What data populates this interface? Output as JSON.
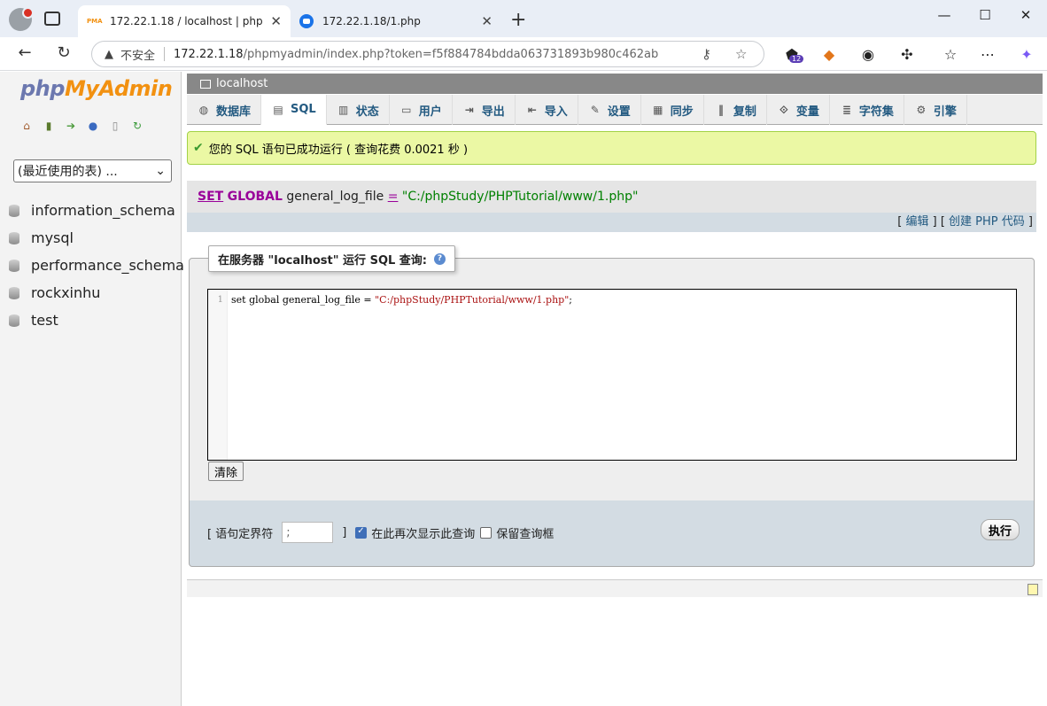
{
  "browser": {
    "tabs": [
      {
        "title": "172.22.1.18 / localhost | phpMyAdmin",
        "favicon": "pma-icon",
        "active": true
      },
      {
        "title": "172.22.1.18/1.php",
        "favicon": "chat-icon",
        "active": false
      }
    ],
    "omnibox": {
      "security_label": "不安全",
      "host": "172.22.1.18",
      "path": "/phpmyadmin/index.php?token=f5f884784bdda063731893b980c462ab"
    },
    "extension_badge": "12"
  },
  "sidebar": {
    "logo": {
      "php": "php",
      "my": "My",
      "admin": "Admin"
    },
    "recent_select": "(最近使用的表) ...",
    "databases": [
      "information_schema",
      "mysql",
      "performance_schema",
      "rockxinhu",
      "test"
    ]
  },
  "server_bar": {
    "label": "localhost"
  },
  "topmenu": [
    {
      "label": "数据库",
      "icon": "database-icon"
    },
    {
      "label": "SQL",
      "icon": "sql-icon"
    },
    {
      "label": "状态",
      "icon": "status-icon"
    },
    {
      "label": "用户",
      "icon": "users-icon"
    },
    {
      "label": "导出",
      "icon": "export-icon"
    },
    {
      "label": "导入",
      "icon": "import-icon"
    },
    {
      "label": "设置",
      "icon": "wrench-icon"
    },
    {
      "label": "同步",
      "icon": "sync-icon"
    },
    {
      "label": "复制",
      "icon": "replication-icon"
    },
    {
      "label": "变量",
      "icon": "variables-icon"
    },
    {
      "label": "字符集",
      "icon": "charset-icon"
    },
    {
      "label": "引擎",
      "icon": "engines-icon"
    }
  ],
  "success_message": "您的 SQL 语句已成功运行 ( 查询花费 0.0021 秒 )",
  "executed_sql": {
    "kw_set": "SET",
    "kw_global": "GLOBAL",
    "var": "general_log_file",
    "op": "=",
    "value": "\"C:/phpStudy/PHPTutorial/www/1.php\""
  },
  "sql_links": {
    "edit": "编辑",
    "create_php": "创建 PHP 代码"
  },
  "query_box": {
    "legend": "在服务器 \"localhost\" 运行 SQL 查询:",
    "line_number": "1",
    "code_prefix": "set global general_log_file = ",
    "code_string": "\"C:/phpStudy/PHPTutorial/www/1.php\"",
    "code_suffix": ";",
    "clear_label": "清除"
  },
  "exec": {
    "delimiter_label": "[ 语句定界符",
    "delimiter_value": ";",
    "bracket_close": "]",
    "show_again_label": "在此再次显示此查询",
    "show_again_checked": true,
    "retain_label": "保留查询框",
    "retain_checked": false,
    "go_label": "执行"
  }
}
